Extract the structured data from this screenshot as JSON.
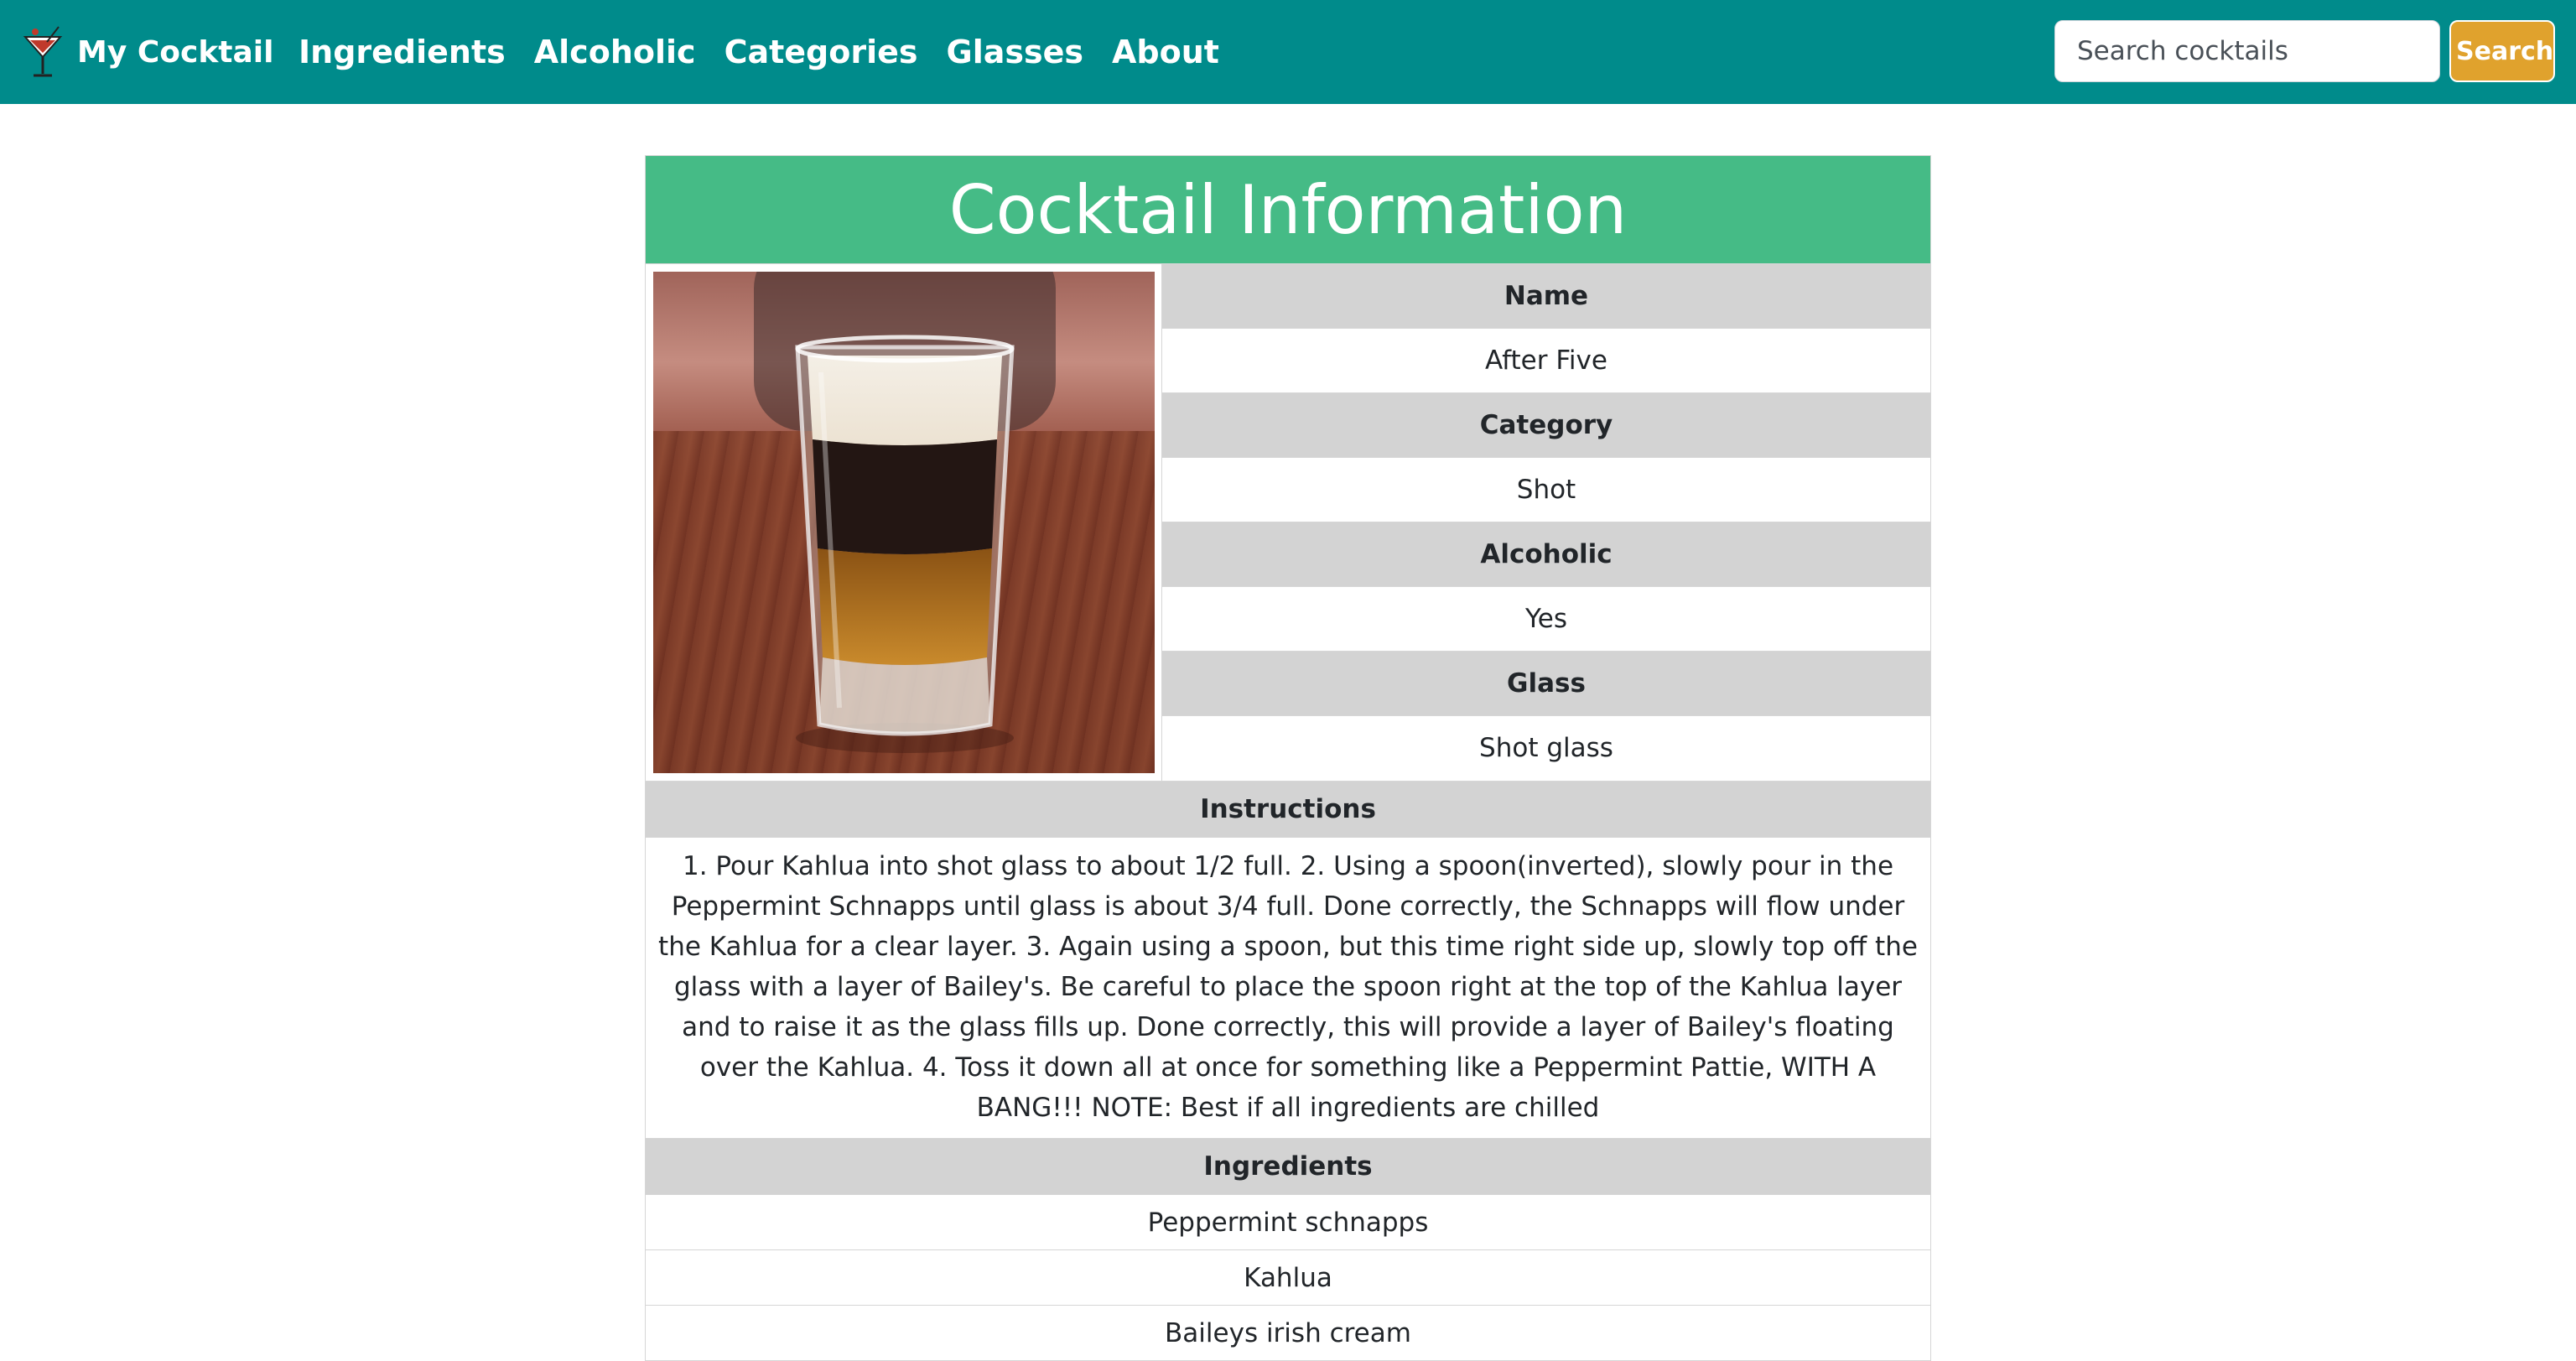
{
  "navbar": {
    "brand": "My Cocktail",
    "links": [
      "Ingredients",
      "Alcoholic",
      "Categories",
      "Glasses",
      "About"
    ],
    "search_placeholder": "Search cocktails",
    "search_button": "Search"
  },
  "cocktail": {
    "header": "Cocktail Information",
    "fields": [
      {
        "label": "Name",
        "value": "After Five"
      },
      {
        "label": "Category",
        "value": "Shot"
      },
      {
        "label": "Alcoholic",
        "value": "Yes"
      },
      {
        "label": "Glass",
        "value": "Shot glass"
      }
    ],
    "instructions_label": "Instructions",
    "instructions": "1. Pour Kahlua into shot glass to about 1/2 full. 2. Using a spoon(inverted), slowly pour in the Peppermint Schnapps until glass is about 3/4 full. Done correctly, the Schnapps will flow under the Kahlua for a clear layer. 3. Again using a spoon, but this time right side up, slowly top off the glass with a layer of Bailey's. Be careful to place the spoon right at the top of the Kahlua layer and to raise it as the glass fills up. Done correctly, this will provide a layer of Bailey's floating over the Kahlua. 4. Toss it down all at once for something like a Peppermint Pattie, WITH A BANG!!! NOTE: Best if all ingredients are chilled",
    "ingredients_label": "Ingredients",
    "ingredients": [
      "Peppermint schnapps",
      "Kahlua",
      "Baileys irish cream"
    ]
  },
  "icons": {
    "brand": "cocktail-glass-icon"
  }
}
